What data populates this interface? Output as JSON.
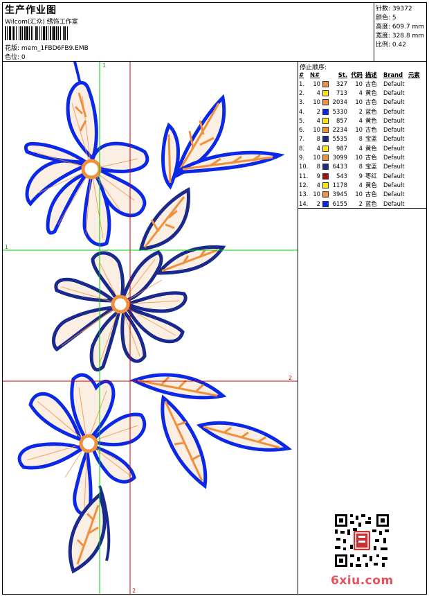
{
  "header": {
    "title": "生产作业图",
    "company": "Wilcom(汇众) 绣饰工作室",
    "pattern_label": "花版:",
    "pattern_value": "mem_1FBD6FB9.EMB",
    "colorpos_label": "色位:",
    "colorpos_value": "0"
  },
  "stats": [
    {
      "label": "针数:",
      "value": "39372"
    },
    {
      "label": "颜色:",
      "value": "5"
    },
    {
      "label": "高度:",
      "value": "609.7 mm"
    },
    {
      "label": "宽度:",
      "value": "328.8 mm"
    },
    {
      "label": "比例:",
      "value": "0.42"
    }
  ],
  "stop_sequence": {
    "title": "停止顺序:",
    "columns": [
      "#",
      "N#",
      "St.",
      "代码",
      "描述",
      "Brand",
      "元素"
    ],
    "rows": [
      {
        "idx": "1.",
        "n": "10",
        "color": "#f0903c",
        "st": "327",
        "code": "10",
        "desc": "古色",
        "brand": "Default"
      },
      {
        "idx": "2.",
        "n": "4",
        "color": "#f5e800",
        "st": "713",
        "code": "4",
        "desc": "黄色",
        "brand": "Default"
      },
      {
        "idx": "3.",
        "n": "10",
        "color": "#f0903c",
        "st": "2034",
        "code": "10",
        "desc": "古色",
        "brand": "Default"
      },
      {
        "idx": "4.",
        "n": "2",
        "color": "#0a28e6",
        "st": "5330",
        "code": "2",
        "desc": "蓝色",
        "brand": "Default"
      },
      {
        "idx": "5.",
        "n": "4",
        "color": "#f5e800",
        "st": "857",
        "code": "4",
        "desc": "黄色",
        "brand": "Default"
      },
      {
        "idx": "6.",
        "n": "10",
        "color": "#f0903c",
        "st": "2234",
        "code": "10",
        "desc": "古色",
        "brand": "Default"
      },
      {
        "idx": "7.",
        "n": "8",
        "color": "#1a2a8c",
        "st": "5535",
        "code": "8",
        "desc": "宝蓝",
        "brand": "Default"
      },
      {
        "idx": "8.",
        "n": "4",
        "color": "#f5e800",
        "st": "987",
        "code": "4",
        "desc": "黄色",
        "brand": "Default"
      },
      {
        "idx": "9.",
        "n": "10",
        "color": "#f0903c",
        "st": "3099",
        "code": "10",
        "desc": "古色",
        "brand": "Default"
      },
      {
        "idx": "10.",
        "n": "8",
        "color": "#1a2a8c",
        "st": "6433",
        "code": "8",
        "desc": "宝蓝",
        "brand": "Default"
      },
      {
        "idx": "11.",
        "n": "9",
        "color": "#a01010",
        "st": "543",
        "code": "9",
        "desc": "枣红",
        "brand": "Default"
      },
      {
        "idx": "12.",
        "n": "4",
        "color": "#f5e800",
        "st": "1178",
        "code": "4",
        "desc": "黄色",
        "brand": "Default"
      },
      {
        "idx": "13.",
        "n": "10",
        "color": "#f0903c",
        "st": "3945",
        "code": "10",
        "desc": "古色",
        "brand": "Default"
      },
      {
        "idx": "14.",
        "n": "2",
        "color": "#0a28e6",
        "st": "6155",
        "code": "2",
        "desc": "蓝色",
        "brand": "Default"
      }
    ]
  },
  "guides": {
    "vertical_1_label": "1",
    "horizontal_1_label": "1",
    "horizontal_2_label": "2",
    "vertical_2_label": "2"
  },
  "colors": {
    "outline_blue": "#0a28e6",
    "outline_navy": "#1a2a8c",
    "fill_orange": "#f0903c",
    "guide_green": "#00cc00",
    "guide_red": "#cc0000"
  },
  "watermark": "6xiu.com"
}
